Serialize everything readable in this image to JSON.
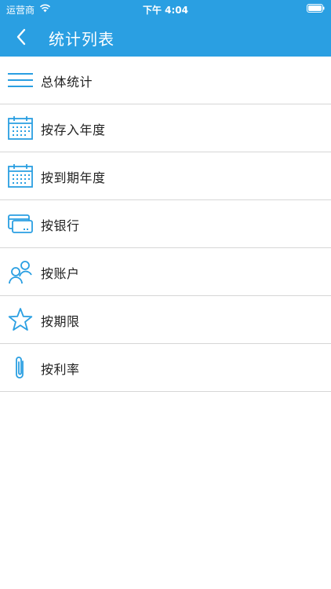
{
  "status_bar": {
    "carrier": "运营商",
    "time": "下午 4:04"
  },
  "nav": {
    "title": "统计列表",
    "back_icon": "chevron-left-icon"
  },
  "items": [
    {
      "label": "总体统计",
      "icon": "menu-lines-icon"
    },
    {
      "label": "按存入年度",
      "icon": "calendar-icon"
    },
    {
      "label": "按到期年度",
      "icon": "calendar-icon"
    },
    {
      "label": "按银行",
      "icon": "bank-card-icon"
    },
    {
      "label": "按账户",
      "icon": "users-icon"
    },
    {
      "label": "按期限",
      "icon": "star-icon"
    },
    {
      "label": "按利率",
      "icon": "paperclip-icon"
    }
  ],
  "colors": {
    "accent": "#2a9fe2",
    "divider": "#d6d6d6",
    "text": "#222222"
  }
}
